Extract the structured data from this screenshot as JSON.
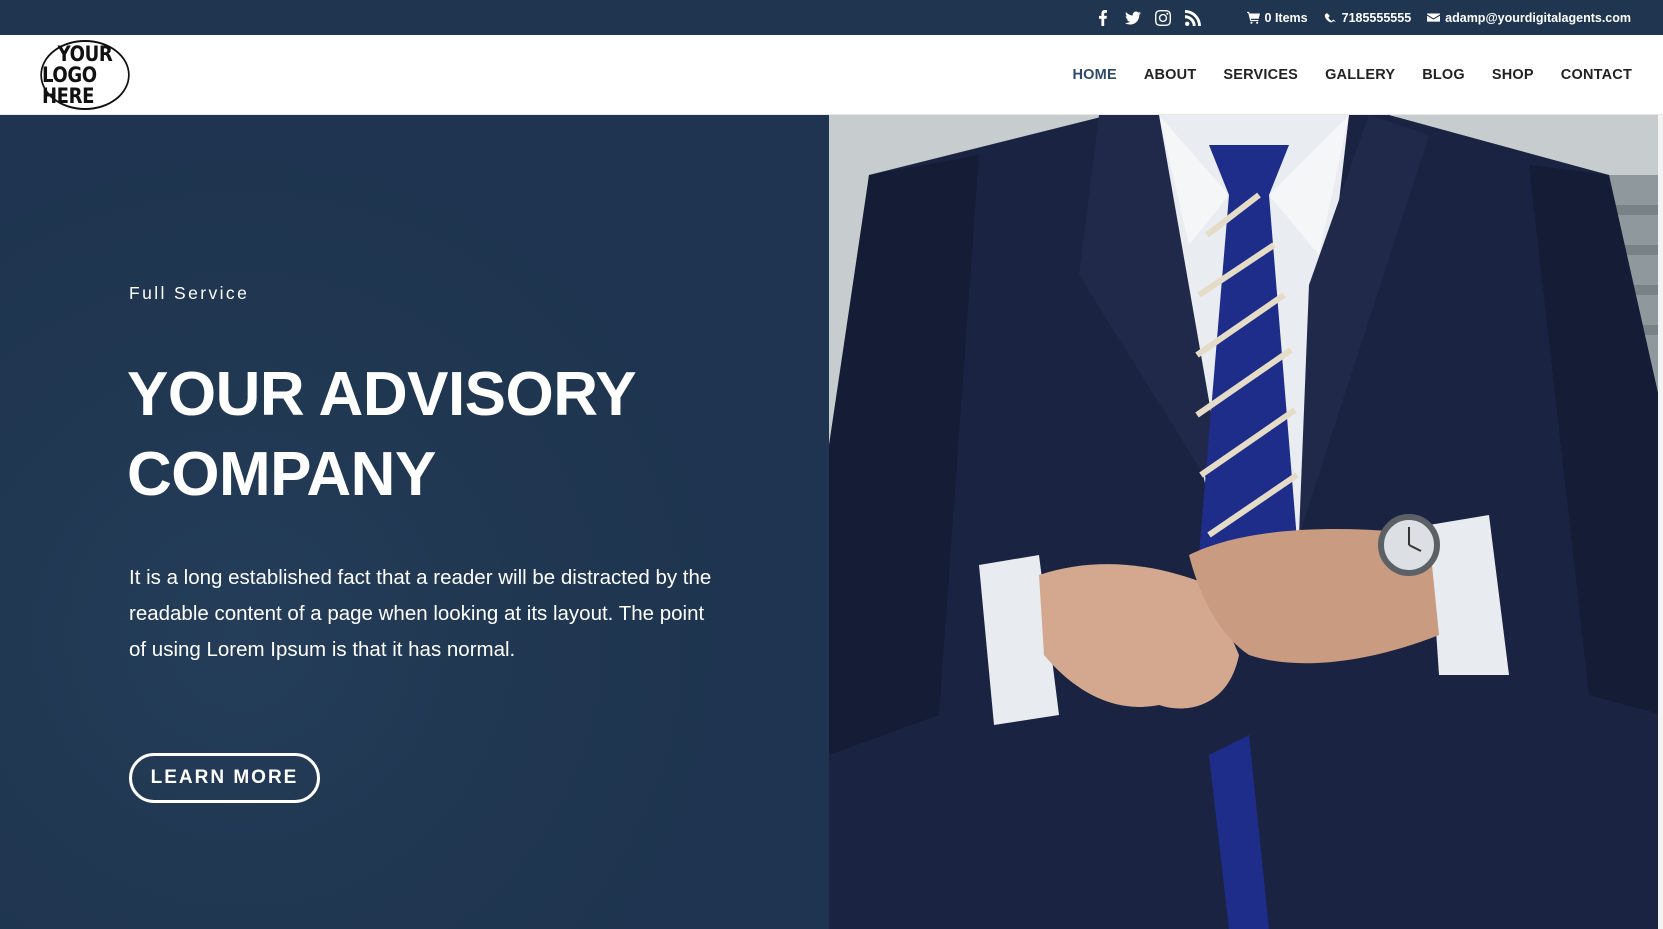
{
  "topbar": {
    "social_icons": [
      "facebook-icon",
      "twitter-icon",
      "instagram-icon",
      "rss-icon"
    ],
    "cart_label": "0 Items",
    "phone": "7185555555",
    "email": "adamp@yourdigitalagents.com"
  },
  "header": {
    "logo": {
      "line1": "YOUR",
      "line2": "LOGO HERE"
    },
    "nav": [
      {
        "label": "HOME",
        "active": true
      },
      {
        "label": "ABOUT"
      },
      {
        "label": "SERVICES"
      },
      {
        "label": "GALLERY"
      },
      {
        "label": "BLOG"
      },
      {
        "label": "SHOP"
      },
      {
        "label": "CONTACT"
      }
    ]
  },
  "hero": {
    "eyebrow": "Full Service",
    "title_line1": "YOUR ADVISORY",
    "title_line2": "COMPANY",
    "description": "It is a long established fact that a reader will be distracted by the readable content of a page when looking at its layout. The point of using Lorem Ipsum is that it has normal.",
    "button_label": "LEARN MORE",
    "image": "man-in-navy-suit-buttoning-jacket-photo"
  },
  "colors": {
    "brand_navy": "#1f3550",
    "nav_active": "#2e4a6b",
    "text_dark": "#222222",
    "white": "#ffffff"
  }
}
